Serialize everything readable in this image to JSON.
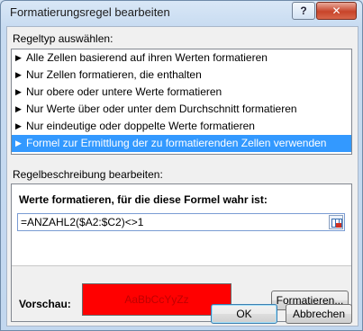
{
  "window": {
    "title": "Formatierungsregel bearbeiten",
    "help_label": "?",
    "close_label": "✕"
  },
  "rule_type": {
    "label": "Regeltyp auswählen:",
    "items": [
      {
        "label": "Alle Zellen basierend auf ihren Werten formatieren"
      },
      {
        "label": "Nur Zellen formatieren, die enthalten"
      },
      {
        "label": "Nur obere oder untere Werte formatieren"
      },
      {
        "label": "Nur Werte über oder unter dem Durchschnitt formatieren"
      },
      {
        "label": "Nur eindeutige oder doppelte Werte formatieren"
      },
      {
        "label": "Formel zur Ermittlung der zu formatierenden Zellen verwenden",
        "selected": true
      }
    ]
  },
  "rule_description": {
    "label": "Regelbeschreibung bearbeiten:",
    "formula_label": "Werte formatieren, für die diese Formel wahr ist:",
    "formula_value": "=ANZAHL2($A2:$C2)<>1",
    "preview_label": "Vorschau:",
    "preview_text": "AaBbCcYyZz",
    "format_button": "Formatieren..."
  },
  "buttons": {
    "ok": "OK",
    "cancel": "Abbrechen"
  },
  "colors": {
    "selection": "#3399ff",
    "preview_fill": "#ff0000",
    "preview_text": "#c00000"
  }
}
